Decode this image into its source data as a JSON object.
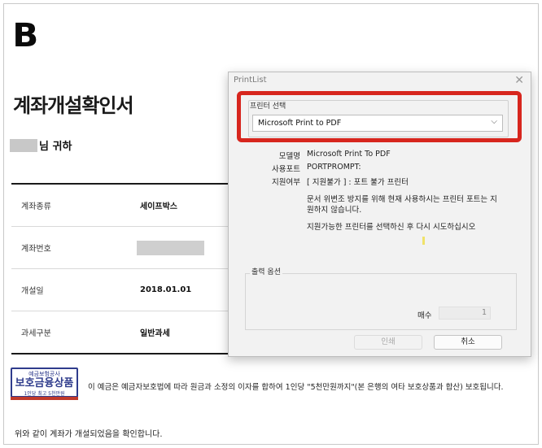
{
  "document": {
    "logo": "B",
    "title": "계좌개설확인서",
    "addressee_suffix": "님 귀하",
    "rows": [
      {
        "label": "계좌종류",
        "value": "세이프박스"
      },
      {
        "label": "계좌번호",
        "value": ""
      },
      {
        "label": "개설일",
        "value": "2018.01.01"
      },
      {
        "label": "과세구분",
        "value": "일반과세"
      }
    ],
    "seal": {
      "line1": "예금보험공사",
      "line2": "보호금융상품",
      "line3": "1인당 최고 5천만원"
    },
    "notice": "이 예금은 예금자보호법에 따라 원금과 소정의 이자를 합하여 1인당 \"5천만원까지\"(본 은행의 여타 보호상품과 합산) 보호됩니다.",
    "confirm": "위와 같이 계좌가 개설되었음을 확인합니다."
  },
  "dialog": {
    "title": "PrintList",
    "close_glyph": "✕",
    "printer_group_label": "프린터 선택",
    "selected_printer": "Microsoft Print to PDF",
    "model_label": "모델명",
    "model_value": "Microsoft Print To PDF",
    "port_label": "사용포트",
    "port_value": "PORTPROMPT:",
    "support_label": "지원여부",
    "support_value": "[ 지원불가 ] : 포트 불가 프린터",
    "message1": "문서 위변조 방지를 위해 현재 사용하시는 프린터 포트는 지원하지 않습니다.",
    "message2": "지원가능한 프린터를 선택하신 후 다시 시도하십시오",
    "output_options_label": "출력 옵션",
    "copies_label": "매수",
    "copies_value": "1",
    "print_button": "인쇄",
    "cancel_button": "취소"
  },
  "colors": {
    "highlight": "#d7261e",
    "seal_blue": "#2f3c8c"
  }
}
